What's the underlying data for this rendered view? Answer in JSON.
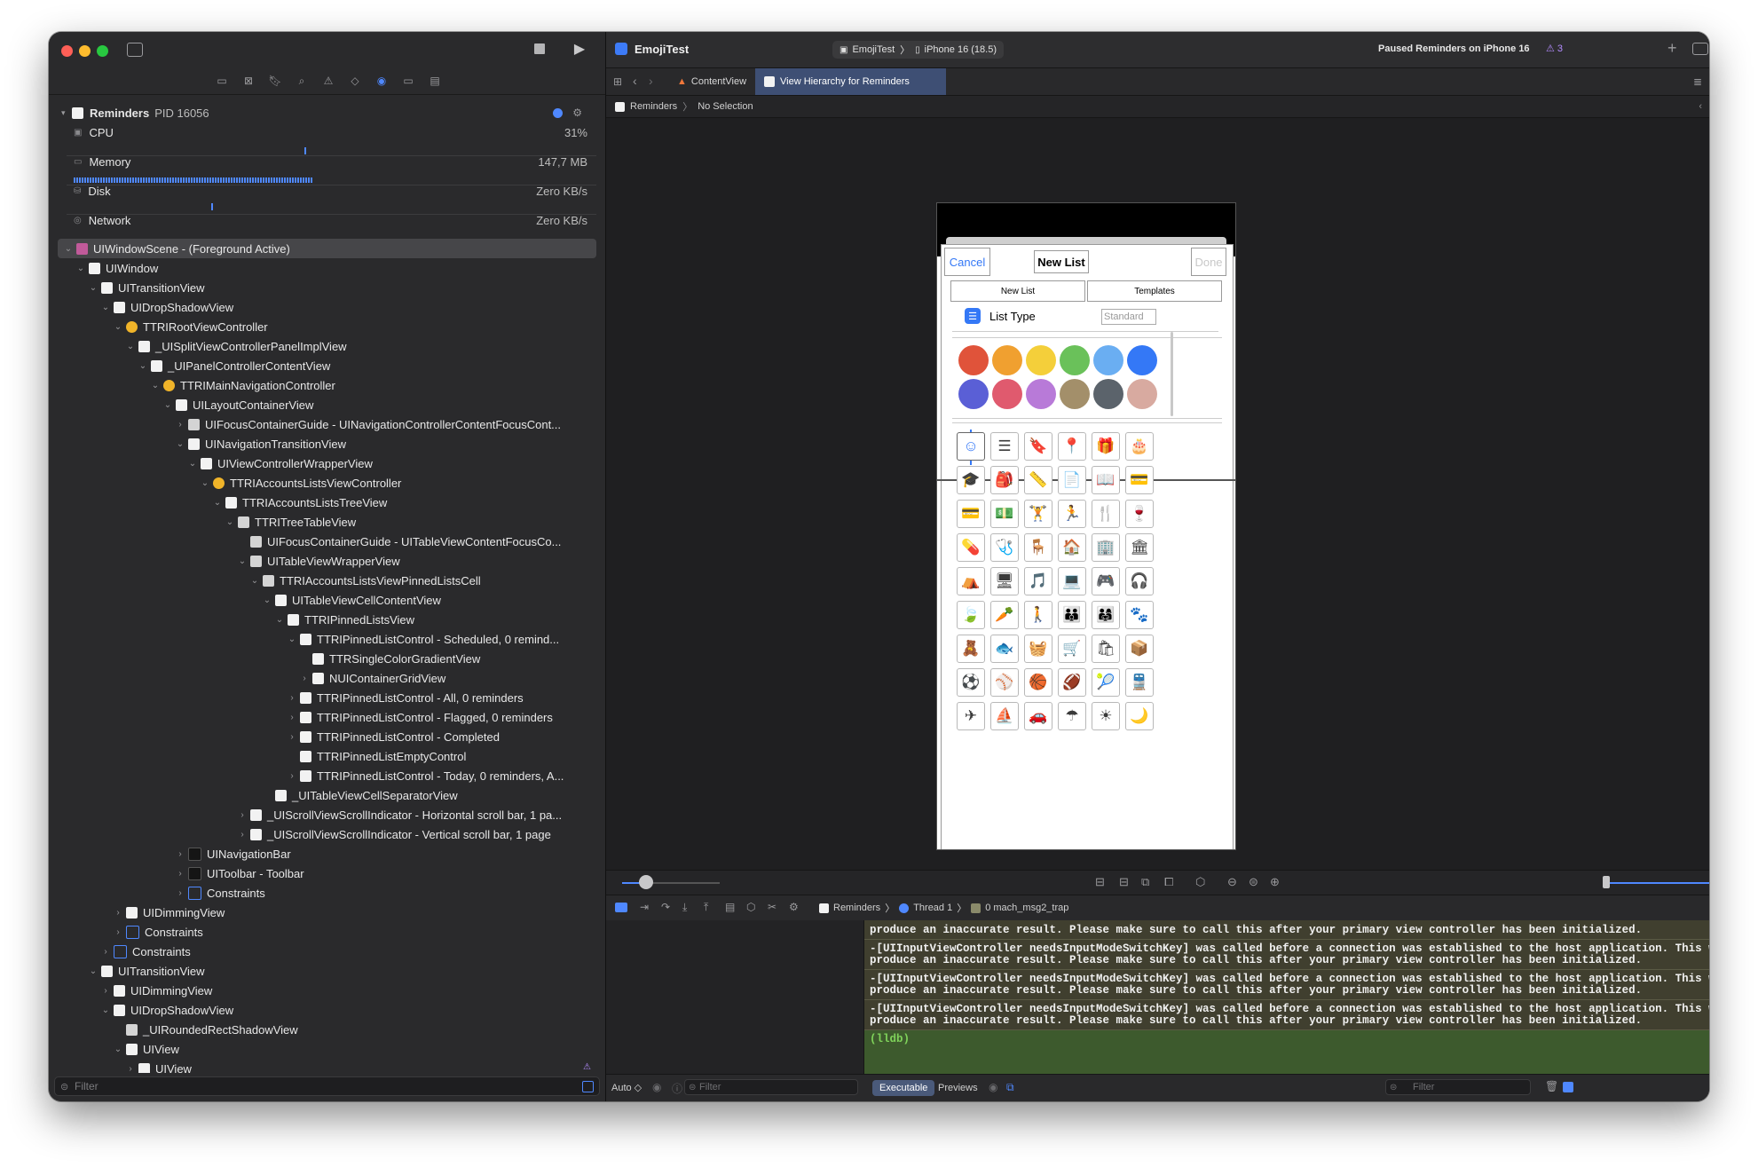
{
  "navigator": {
    "process": {
      "name": "Reminders",
      "pid": "PID 16056"
    },
    "gauges": [
      {
        "label": "CPU",
        "value": "31%"
      },
      {
        "label": "Memory",
        "value": "147,7 MB"
      },
      {
        "label": "Disk",
        "value": "Zero KB/s"
      },
      {
        "label": "Network",
        "value": "Zero KB/s"
      }
    ],
    "tree": [
      {
        "label": "UIWindowScene - (Foreground Active)",
        "depth": 0,
        "icon": "p",
        "open": true,
        "selected": true
      },
      {
        "label": "UIWindow",
        "depth": 1,
        "icon": "w",
        "open": true
      },
      {
        "label": "UITransitionView",
        "depth": 2,
        "icon": "w",
        "open": true
      },
      {
        "label": "UIDropShadowView",
        "depth": 3,
        "icon": "w",
        "open": true
      },
      {
        "label": "TTRIRootViewController",
        "depth": 4,
        "icon": "y",
        "open": true
      },
      {
        "label": "_UISplitViewControllerPanelImplView",
        "depth": 5,
        "icon": "w",
        "open": true
      },
      {
        "label": "_UIPanelControllerContentView",
        "depth": 6,
        "icon": "w",
        "open": true
      },
      {
        "label": "TTRIMainNavigationController",
        "depth": 7,
        "icon": "y",
        "open": true
      },
      {
        "label": "UILayoutContainerView",
        "depth": 8,
        "icon": "w",
        "open": true
      },
      {
        "label": "UIFocusContainerGuide - UINavigationControllerContentFocusCont...",
        "depth": 9,
        "icon": "g",
        "open": false
      },
      {
        "label": "UINavigationTransitionView",
        "depth": 9,
        "icon": "w",
        "open": true
      },
      {
        "label": "UIViewControllerWrapperView",
        "depth": 10,
        "icon": "w",
        "open": true
      },
      {
        "label": "TTRIAccountsListsViewController",
        "depth": 11,
        "icon": "y",
        "open": true
      },
      {
        "label": "TTRIAccountsListsTreeView",
        "depth": 12,
        "icon": "w",
        "open": true
      },
      {
        "label": "TTRITreeTableView",
        "depth": 13,
        "icon": "g",
        "open": true
      },
      {
        "label": "UIFocusContainerGuide - UITableViewContentFocusCo...",
        "depth": 14,
        "icon": "g",
        "open": null
      },
      {
        "label": "UITableViewWrapperView",
        "depth": 14,
        "icon": "g",
        "open": true
      },
      {
        "label": "TTRIAccountsListsViewPinnedListsCell",
        "depth": 15,
        "icon": "g",
        "open": true
      },
      {
        "label": "UITableViewCellContentView",
        "depth": 16,
        "icon": "w",
        "open": true
      },
      {
        "label": "TTRIPinnedListsView",
        "depth": 17,
        "icon": "w",
        "open": true
      },
      {
        "label": "TTRIPinnedListControl - Scheduled, 0 remind...",
        "depth": 18,
        "icon": "w",
        "open": true
      },
      {
        "label": "TTRSingleColorGradientView",
        "depth": 19,
        "icon": "w",
        "open": null
      },
      {
        "label": "NUIContainerGridView",
        "depth": 19,
        "icon": "w",
        "open": false
      },
      {
        "label": "TTRIPinnedListControl - All, 0 reminders",
        "depth": 18,
        "icon": "w",
        "open": false
      },
      {
        "label": "TTRIPinnedListControl - Flagged, 0 reminders",
        "depth": 18,
        "icon": "w",
        "open": false
      },
      {
        "label": "TTRIPinnedListControl - Completed",
        "depth": 18,
        "icon": "w",
        "open": false
      },
      {
        "label": "TTRIPinnedListEmptyControl",
        "depth": 18,
        "icon": "w",
        "open": null
      },
      {
        "label": "TTRIPinnedListControl - Today, 0 reminders, A...",
        "depth": 18,
        "icon": "w",
        "open": false
      },
      {
        "label": "_UITableViewCellSeparatorView",
        "depth": 16,
        "icon": "w",
        "open": null
      },
      {
        "label": "_UIScrollViewScrollIndicator - Horizontal scroll bar, 1 pa...",
        "depth": 14,
        "icon": "w",
        "open": false
      },
      {
        "label": "_UIScrollViewScrollIndicator - Vertical scroll bar, 1 page",
        "depth": 14,
        "icon": "w",
        "open": false
      },
      {
        "label": "UINavigationBar",
        "depth": 9,
        "icon": "d",
        "open": false
      },
      {
        "label": "UIToolbar - Toolbar",
        "depth": 9,
        "icon": "d",
        "open": false
      },
      {
        "label": "Constraints",
        "depth": 9,
        "icon": "b",
        "open": false
      },
      {
        "label": "UIDimmingView",
        "depth": 4,
        "icon": "w",
        "open": false
      },
      {
        "label": "Constraints",
        "depth": 4,
        "icon": "b",
        "open": false
      },
      {
        "label": "Constraints",
        "depth": 3,
        "icon": "b",
        "open": false
      },
      {
        "label": "UITransitionView",
        "depth": 2,
        "icon": "w",
        "open": true
      },
      {
        "label": "UIDimmingView",
        "depth": 3,
        "icon": "w",
        "open": false
      },
      {
        "label": "UIDropShadowView",
        "depth": 3,
        "icon": "w",
        "open": true
      },
      {
        "label": "_UIRoundedRectShadowView",
        "depth": 4,
        "icon": "g",
        "open": null
      },
      {
        "label": "UIView",
        "depth": 4,
        "icon": "w",
        "open": true
      },
      {
        "label": "UIView",
        "depth": 5,
        "icon": "w",
        "open": false
      }
    ],
    "filter_placeholder": "Filter"
  },
  "toolbar": {
    "project": "EmojiTest",
    "scheme": "EmojiTest",
    "destination": "iPhone 16 (18.5)",
    "status": "Paused Reminders on iPhone 16",
    "warnings": "3"
  },
  "tabs": [
    {
      "label": "ContentView",
      "active": false
    },
    {
      "label": "View Hierarchy for Reminders",
      "active": true
    }
  ],
  "jumpbar": {
    "root": "Reminders",
    "selection": "No Selection"
  },
  "phone": {
    "cancel": "Cancel",
    "title": "New List",
    "done": "Done",
    "segments": [
      "New List",
      "Templates"
    ],
    "list_type_label": "List Type",
    "list_type_value": "Standard",
    "colors": [
      "#e0533a",
      "#f0a030",
      "#f4cf3a",
      "#6ac15a",
      "#6aaef2",
      "#3478f6",
      "#5a5fd6",
      "#e05a6e",
      "#b87ad8",
      "#a38f6a",
      "#5b636b",
      "#d8aaa0"
    ],
    "icons": [
      "☺",
      "☰",
      "🔖",
      "📍",
      "🎁",
      "🎂",
      "🎓",
      "🎒",
      "📏",
      "📄",
      "📖",
      "💳",
      "💳",
      "💵",
      "🏋",
      "🏃",
      "🍴",
      "🍷",
      "💊",
      "🩺",
      "🪑",
      "🏠",
      "🏢",
      "🏛",
      "⛺",
      "🖥",
      "🎵",
      "💻",
      "🎮",
      "🎧",
      "🍃",
      "🥕",
      "🚶",
      "👪",
      "👨‍👩‍👧",
      "🐾",
      "🧸",
      "🐟",
      "🧺",
      "🛒",
      "🛍",
      "📦",
      "⚽",
      "⚾",
      "🏀",
      "🏈",
      "🎾",
      "🚆",
      "✈",
      "⛵",
      "🚗",
      "☂",
      "☀",
      "🌙"
    ]
  },
  "debug": {
    "breadcrumb": [
      "Reminders",
      "Thread 1",
      "0 mach_msg2_trap"
    ]
  },
  "console": {
    "lines": [
      "produce an inaccurate result. Please make sure to call this after your primary view controller has been initialized.",
      "-[UIInputViewController needsInputModeSwitchKey] was called before a connection was established to the host application. This w",
      "produce an inaccurate result. Please make sure to call this after your primary view controller has been initialized.",
      "-[UIInputViewController needsInputModeSwitchKey] was called before a connection was established to the host application. This w",
      "produce an inaccurate result. Please make sure to call this after your primary view controller has been initialized.",
      "-[UIInputViewController needsInputModeSwitchKey] was called before a connection was established to the host application. This w",
      "produce an inaccurate result. Please make sure to call this after your primary view controller has been initialized."
    ],
    "prompt": "(lldb)"
  },
  "bottombar": {
    "auto_label": "Auto ◇",
    "vars_filter_placeholder": "Filter",
    "executable_label": "Executable",
    "previews_label": "Previews",
    "console_filter_placeholder": "Filter"
  }
}
